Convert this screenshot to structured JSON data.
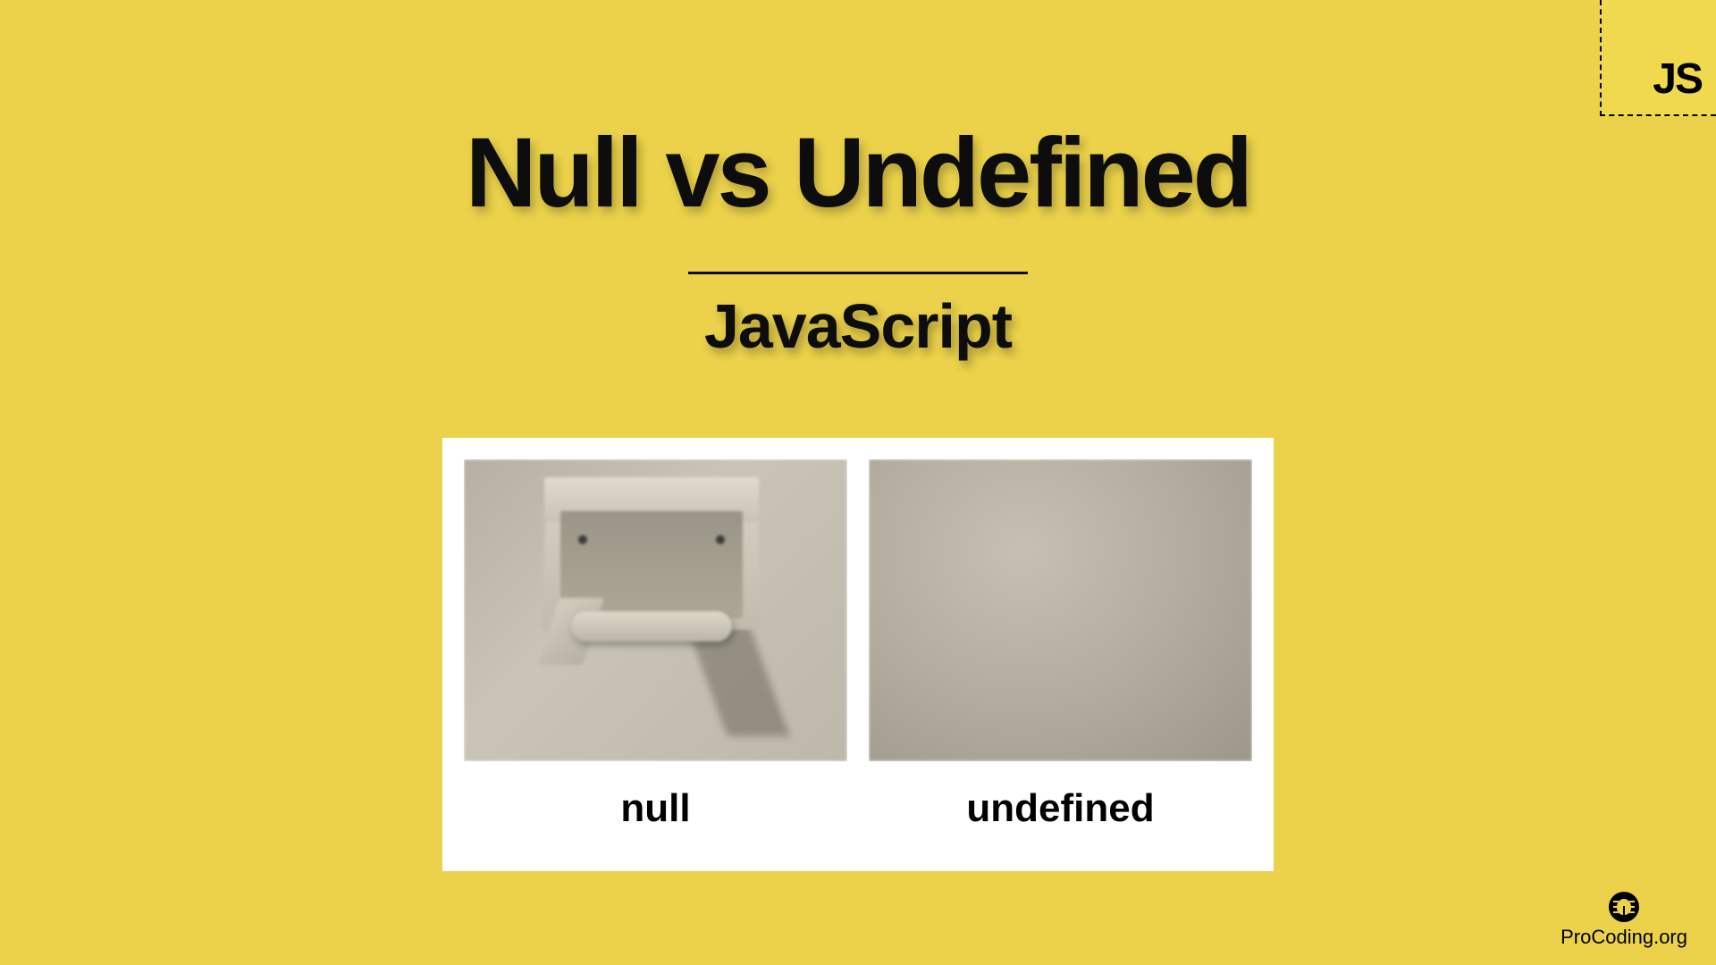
{
  "badge": {
    "text": "JS"
  },
  "title": "Null vs Undefined",
  "subtitle": "JavaScript",
  "meme": {
    "left_caption": "null",
    "right_caption": "undefined"
  },
  "branding": {
    "text": "ProCoding.org",
    "icon": "bug-icon"
  },
  "colors": {
    "background": "#ebd24a",
    "text": "#0d0d0d"
  }
}
